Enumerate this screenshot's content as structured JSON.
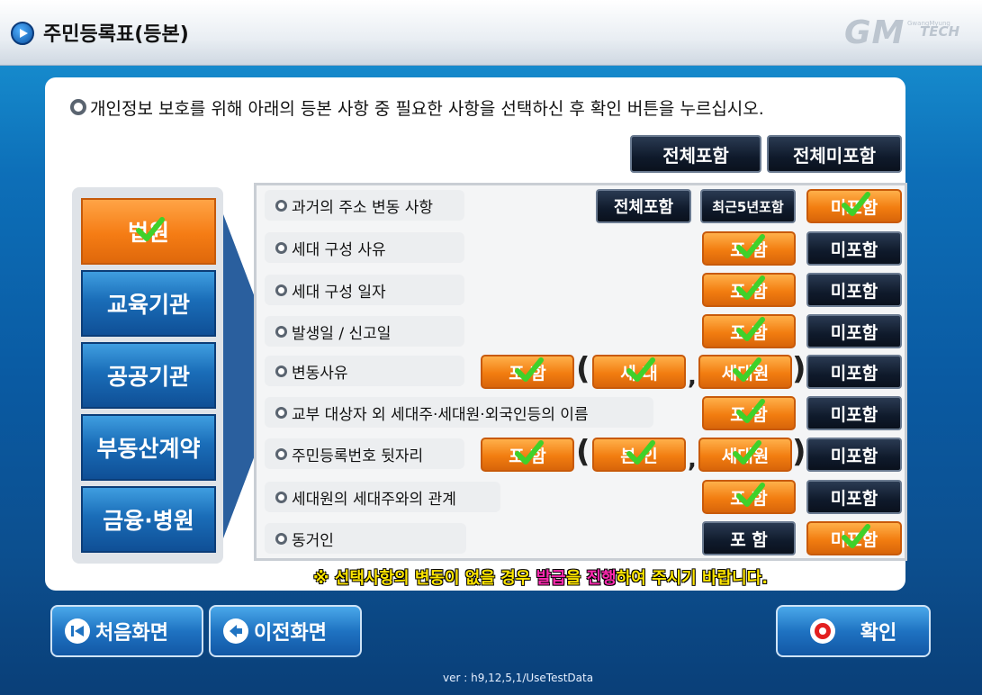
{
  "header": {
    "title": "주민등록표(등본)",
    "logo_main": "GM",
    "logo_sub": "TECH",
    "logo_mini": "GwangMyung"
  },
  "instruction": "개인정보 보호를 위해 아래의 등본 사항 중 필요한 사항을 선택하신 후 확인 버튼을 누르십시오.",
  "global_buttons": {
    "include_all": "전체포함",
    "exclude_all": "전체미포함"
  },
  "categories": [
    {
      "label": "법원",
      "selected": true
    },
    {
      "label": "교육기관",
      "selected": false
    },
    {
      "label": "공공기관",
      "selected": false
    },
    {
      "label": "부동산계약",
      "selected": false
    },
    {
      "label": "금융·병원",
      "selected": false
    }
  ],
  "rows": [
    {
      "label": "과거의 주소 변동 사항",
      "include_all": "전체포함",
      "recent5": "최근5년포함",
      "exclude": "미포함",
      "selected": "미포함"
    },
    {
      "label": "세대 구성 사유",
      "include": "포 함",
      "exclude": "미포함",
      "selected": "포 함"
    },
    {
      "label": "세대 구성 일자",
      "include": "포 함",
      "exclude": "미포함",
      "selected": "포 함"
    },
    {
      "label": "발생일 / 신고일",
      "include": "포 함",
      "exclude": "미포함",
      "selected": "포 함"
    },
    {
      "label": "변동사유",
      "include": "포 함",
      "sub1": "세 대",
      "sub2": "세대원",
      "exclude": "미포함",
      "selected": "포 함"
    },
    {
      "label": "교부 대상자 외 세대주·세대원·외국인등의 이름",
      "include": "포 함",
      "exclude": "미포함",
      "selected": "포 함"
    },
    {
      "label": "주민등록번호 뒷자리",
      "include": "포 함",
      "sub1": "본 인",
      "sub2": "세대원",
      "exclude": "미포함",
      "selected": "포 함"
    },
    {
      "label": "세대원의 세대주와의 관계",
      "include": "포 함",
      "exclude": "미포함",
      "selected": "포 함"
    },
    {
      "label": "동거인",
      "include": "포 함",
      "exclude": "미포함",
      "selected": "미포함"
    }
  ],
  "notice": {
    "part1": "※ 선택사항의 변동이 없을 경우 ",
    "highlight1": "발급",
    "part2": "을 ",
    "highlight2": "진행",
    "part3": "하여 주시기 바랍니다."
  },
  "footer": {
    "home_button": "처음화면",
    "prev_button": "이전화면",
    "confirm_button": "확인",
    "version": "ver : h9,12,5,1/UseTestData"
  },
  "colors": {
    "accent_orange": "#f27d10",
    "dark_button": "#0f1a2b",
    "primary_blue": "#1f73c2",
    "notice_yellow": "#ffe600",
    "notice_pink": "#ff2ab0"
  }
}
